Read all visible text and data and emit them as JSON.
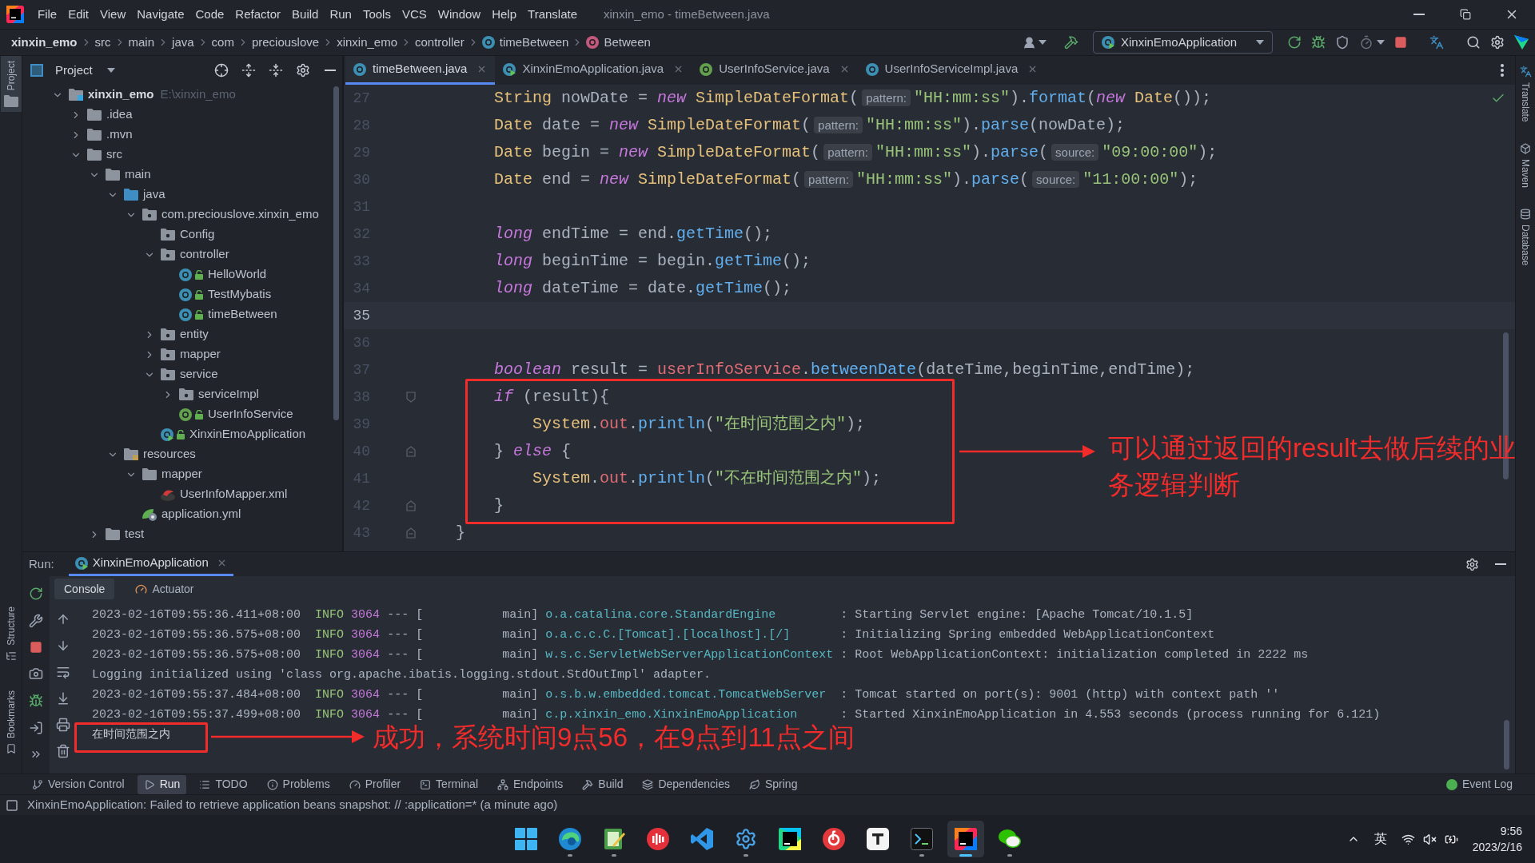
{
  "title_bar": {
    "menu": [
      "File",
      "Edit",
      "View",
      "Navigate",
      "Code",
      "Refactor",
      "Build",
      "Run",
      "Tools",
      "VCS",
      "Window",
      "Help",
      "Translate"
    ],
    "title": "xinxin_emo - timeBetween.java"
  },
  "navigation_bar": {
    "breadcrumbs": [
      {
        "label": "xinxin_emo",
        "kind": "project"
      },
      {
        "label": "src",
        "kind": "folder"
      },
      {
        "label": "main",
        "kind": "folder"
      },
      {
        "label": "java",
        "kind": "folder"
      },
      {
        "label": "com",
        "kind": "folder"
      },
      {
        "label": "preciouslove",
        "kind": "folder"
      },
      {
        "label": "xinxin_emo",
        "kind": "folder"
      },
      {
        "label": "controller",
        "kind": "folder"
      },
      {
        "label": "timeBetween",
        "kind": "class"
      },
      {
        "label": "Between",
        "kind": "method"
      }
    ],
    "run_configuration": "XinxinEmoApplication"
  },
  "left_stripe": {
    "top": [
      {
        "label": "Project",
        "kind": "project",
        "selected": true
      }
    ],
    "bottom": [
      {
        "label": "Structure",
        "kind": "structure",
        "selected": false
      },
      {
        "label": "Bookmarks",
        "kind": "bookmarks",
        "selected": false
      }
    ]
  },
  "project_panel": {
    "title": "Project",
    "tree": [
      {
        "label": "xinxin_emo",
        "path": "E:\\xinxin_emo",
        "kind": "module",
        "expanded": true,
        "children": [
          {
            "label": ".idea",
            "kind": "folder",
            "expanded": false
          },
          {
            "label": ".mvn",
            "kind": "folder",
            "expanded": false
          },
          {
            "label": "src",
            "kind": "folder",
            "expanded": true,
            "children": [
              {
                "label": "main",
                "kind": "folder",
                "expanded": true,
                "children": [
                  {
                    "label": "java",
                    "kind": "source",
                    "expanded": true,
                    "children": [
                      {
                        "label": "com.preciouslove.xinxin_emo",
                        "kind": "package",
                        "expanded": true,
                        "children": [
                          {
                            "label": "Config",
                            "kind": "package"
                          },
                          {
                            "label": "controller",
                            "kind": "package",
                            "expanded": true,
                            "children": [
                              {
                                "label": "HelloWorld",
                                "kind": "class"
                              },
                              {
                                "label": "TestMybatis",
                                "kind": "class"
                              },
                              {
                                "label": "timeBetween",
                                "kind": "class"
                              }
                            ]
                          },
                          {
                            "label": "entity",
                            "kind": "package",
                            "expanded": false
                          },
                          {
                            "label": "mapper",
                            "kind": "package",
                            "expanded": false
                          },
                          {
                            "label": "service",
                            "kind": "package",
                            "expanded": true,
                            "children": [
                              {
                                "label": "serviceImpl",
                                "kind": "package",
                                "expanded": false
                              },
                              {
                                "label": "UserInfoService",
                                "kind": "interface"
                              }
                            ]
                          },
                          {
                            "label": "XinxinEmoApplication",
                            "kind": "app"
                          }
                        ]
                      }
                    ]
                  },
                  {
                    "label": "resources",
                    "kind": "resources",
                    "expanded": true,
                    "children": [
                      {
                        "label": "mapper",
                        "kind": "folder",
                        "expanded": true,
                        "children": [
                          {
                            "label": "UserInfoMapper.xml",
                            "kind": "xml"
                          }
                        ]
                      },
                      {
                        "label": "application.yml",
                        "kind": "yml"
                      }
                    ]
                  }
                ]
              },
              {
                "label": "test",
                "kind": "folder",
                "expanded": false
              }
            ]
          }
        ]
      }
    ]
  },
  "editor": {
    "tabs": [
      {
        "label": "timeBetween.java",
        "kind": "class",
        "selected": true
      },
      {
        "label": "XinxinEmoApplication.java",
        "kind": "app",
        "selected": false
      },
      {
        "label": "UserInfoService.java",
        "kind": "interface",
        "selected": false
      },
      {
        "label": "UserInfoServiceImpl.java",
        "kind": "class",
        "selected": false
      }
    ],
    "lines": [
      {
        "number": "27",
        "kind": "plain",
        "current": false,
        "tokens": [
          {
            "text": "        String",
            "kind": "type"
          },
          {
            "text": " nowDate = ",
            "kind": "plain"
          },
          {
            "text": "new",
            "kind": "kw"
          },
          {
            "text": " SimpleDateFormat",
            "kind": "type"
          },
          {
            "text": "(",
            "kind": "plain"
          },
          {
            "text": "pattern:",
            "kind": "hint"
          },
          {
            "text": "\"HH:mm:ss\"",
            "kind": "str"
          },
          {
            "text": ").",
            "kind": "plain"
          },
          {
            "text": "format",
            "kind": "method"
          },
          {
            "text": "(",
            "kind": "plain"
          },
          {
            "text": "new",
            "kind": "kw"
          },
          {
            "text": " Date",
            "kind": "type"
          },
          {
            "text": "());",
            "kind": "plain"
          }
        ]
      },
      {
        "number": "28",
        "kind": "plain",
        "current": false,
        "tokens": [
          {
            "text": "        Date",
            "kind": "type"
          },
          {
            "text": " date = ",
            "kind": "plain"
          },
          {
            "text": "new",
            "kind": "kw"
          },
          {
            "text": " SimpleDateFormat",
            "kind": "type"
          },
          {
            "text": "(",
            "kind": "plain"
          },
          {
            "text": "pattern:",
            "kind": "hint"
          },
          {
            "text": "\"HH:mm:ss\"",
            "kind": "str"
          },
          {
            "text": ").",
            "kind": "plain"
          },
          {
            "text": "parse",
            "kind": "method"
          },
          {
            "text": "(nowDate);",
            "kind": "plain"
          }
        ]
      },
      {
        "number": "29",
        "kind": "plain",
        "current": false,
        "tokens": [
          {
            "text": "        Date",
            "kind": "type"
          },
          {
            "text": " begin = ",
            "kind": "plain"
          },
          {
            "text": "new",
            "kind": "kw"
          },
          {
            "text": " SimpleDateFormat",
            "kind": "type"
          },
          {
            "text": "(",
            "kind": "plain"
          },
          {
            "text": "pattern:",
            "kind": "hint"
          },
          {
            "text": "\"HH:mm:ss\"",
            "kind": "str"
          },
          {
            "text": ").",
            "kind": "plain"
          },
          {
            "text": "parse",
            "kind": "method"
          },
          {
            "text": "(",
            "kind": "plain"
          },
          {
            "text": "source:",
            "kind": "hint"
          },
          {
            "text": "\"09:00:00\"",
            "kind": "str"
          },
          {
            "text": ");",
            "kind": "plain"
          }
        ]
      },
      {
        "number": "30",
        "kind": "plain",
        "current": false,
        "tokens": [
          {
            "text": "        Date",
            "kind": "type"
          },
          {
            "text": " end = ",
            "kind": "plain"
          },
          {
            "text": "new",
            "kind": "kw"
          },
          {
            "text": " SimpleDateFormat",
            "kind": "type"
          },
          {
            "text": "(",
            "kind": "plain"
          },
          {
            "text": "pattern:",
            "kind": "hint"
          },
          {
            "text": "\"HH:mm:ss\"",
            "kind": "str"
          },
          {
            "text": ").",
            "kind": "plain"
          },
          {
            "text": "parse",
            "kind": "method"
          },
          {
            "text": "(",
            "kind": "plain"
          },
          {
            "text": "source:",
            "kind": "hint"
          },
          {
            "text": "\"11:00:00\"",
            "kind": "str"
          },
          {
            "text": ");",
            "kind": "plain"
          }
        ]
      },
      {
        "number": "31",
        "kind": "plain",
        "current": false
      },
      {
        "number": "32",
        "kind": "plain",
        "current": false,
        "tokens": [
          {
            "text": "        long",
            "kind": "kw"
          },
          {
            "text": " endTime = end.",
            "kind": "plain"
          },
          {
            "text": "getTime",
            "kind": "method"
          },
          {
            "text": "();",
            "kind": "plain"
          }
        ]
      },
      {
        "number": "33",
        "kind": "plain",
        "current": false,
        "tokens": [
          {
            "text": "        long",
            "kind": "kw"
          },
          {
            "text": " beginTime = begin.",
            "kind": "plain"
          },
          {
            "text": "getTime",
            "kind": "method"
          },
          {
            "text": "();",
            "kind": "plain"
          }
        ]
      },
      {
        "number": "34",
        "kind": "plain",
        "current": false,
        "tokens": [
          {
            "text": "        long",
            "kind": "kw"
          },
          {
            "text": " dateTime = date.",
            "kind": "plain"
          },
          {
            "text": "getTime",
            "kind": "method"
          },
          {
            "text": "();",
            "kind": "plain"
          }
        ]
      },
      {
        "number": "35",
        "kind": "plain",
        "current": true
      },
      {
        "number": "36",
        "kind": "plain",
        "current": false
      },
      {
        "number": "37",
        "kind": "plain",
        "current": false,
        "tokens": [
          {
            "text": "        boolean",
            "kind": "kw"
          },
          {
            "text": " result = ",
            "kind": "plain"
          },
          {
            "text": "userInfoService",
            "kind": "field"
          },
          {
            "text": ".",
            "kind": "plain"
          },
          {
            "text": "betweenDate",
            "kind": "method"
          },
          {
            "text": "(dateTime,beginTime,endTime);",
            "kind": "plain"
          }
        ]
      },
      {
        "number": "38",
        "kind": "fold-start",
        "current": false,
        "tokens": [
          {
            "text": "        if",
            "kind": "kw"
          },
          {
            "text": " (result){",
            "kind": "plain"
          }
        ]
      },
      {
        "number": "39",
        "kind": "plain",
        "current": false,
        "tokens": [
          {
            "text": "            System",
            "kind": "type"
          },
          {
            "text": ".",
            "kind": "plain"
          },
          {
            "text": "out",
            "kind": "field"
          },
          {
            "text": ".",
            "kind": "plain"
          },
          {
            "text": "println",
            "kind": "method"
          },
          {
            "text": "(",
            "kind": "plain"
          },
          {
            "text": "\"在时间范围之内\"",
            "kind": "str"
          },
          {
            "text": ");",
            "kind": "plain"
          }
        ]
      },
      {
        "number": "40",
        "kind": "fold-end",
        "current": false,
        "tokens": [
          {
            "text": "        } ",
            "kind": "plain"
          },
          {
            "text": "else",
            "kind": "kw"
          },
          {
            "text": " {",
            "kind": "plain"
          }
        ]
      },
      {
        "number": "41",
        "kind": "plain",
        "current": false,
        "tokens": [
          {
            "text": "            System",
            "kind": "type"
          },
          {
            "text": ".",
            "kind": "plain"
          },
          {
            "text": "out",
            "kind": "field"
          },
          {
            "text": ".",
            "kind": "plain"
          },
          {
            "text": "println",
            "kind": "method"
          },
          {
            "text": "(",
            "kind": "plain"
          },
          {
            "text": "\"不在时间范围之内\"",
            "kind": "str"
          },
          {
            "text": ");",
            "kind": "plain"
          }
        ]
      },
      {
        "number": "42",
        "kind": "fold-end",
        "current": false,
        "tokens": [
          {
            "text": "        }",
            "kind": "plain"
          }
        ]
      },
      {
        "number": "43",
        "kind": "fold-end",
        "current": false,
        "tokens": [
          {
            "text": "    }",
            "kind": "plain"
          }
        ]
      }
    ],
    "callout": "可以通过返回的result去做后续的业务逻辑判断"
  },
  "right_stripe": [
    {
      "label": "Translate",
      "kind": "translate"
    },
    {
      "label": "Maven",
      "kind": "maven"
    },
    {
      "label": "Database",
      "kind": "database"
    }
  ],
  "run_panel": {
    "label": "Run:",
    "tabs": [
      {
        "label": "XinxinEmoApplication",
        "selected": true
      }
    ],
    "views": [
      {
        "label": "Console",
        "kind": "console",
        "selected": true
      },
      {
        "label": "Actuator",
        "kind": "actuator",
        "selected": false
      }
    ],
    "lines": [
      {
        "kind": "log",
        "timestamp": "2023-02-16T09:55:36.411+08:00",
        "level": "INFO",
        "pid": "3064",
        "thread": "--- [           main]",
        "logger": "o.a.catalina.core.StandardEngine",
        "message": ": Starting Servlet engine: [Apache Tomcat/10.1.5]"
      },
      {
        "kind": "log",
        "timestamp": "2023-02-16T09:55:36.575+08:00",
        "level": "INFO",
        "pid": "3064",
        "thread": "--- [           main]",
        "logger": "o.a.c.c.C.[Tomcat].[localhost].[/]",
        "message": ": Initializing Spring embedded WebApplicationContext"
      },
      {
        "kind": "log",
        "timestamp": "2023-02-16T09:55:36.575+08:00",
        "level": "INFO",
        "pid": "3064",
        "thread": "--- [           main]",
        "logger": "w.s.c.ServletWebServerApplicationContext",
        "message": ": Root WebApplicationContext: initialization completed in 2222 ms"
      },
      {
        "kind": "plain",
        "text": "Logging initialized using 'class org.apache.ibatis.logging.stdout.StdOutImpl' adapter."
      },
      {
        "kind": "log",
        "timestamp": "2023-02-16T09:55:37.484+08:00",
        "level": "INFO",
        "pid": "3064",
        "thread": "--- [           main]",
        "logger": "o.s.b.w.embedded.tomcat.TomcatWebServer",
        "message": ": Tomcat started on port(s): 9001 (http) with context path ''"
      },
      {
        "kind": "log",
        "timestamp": "2023-02-16T09:55:37.499+08:00",
        "level": "INFO",
        "pid": "3064",
        "thread": "--- [           main]",
        "logger": "c.p.xinxin_emo.XinxinEmoApplication",
        "message": ": Started XinxinEmoApplication in 4.553 seconds (process running for 6.121)"
      },
      {
        "kind": "output",
        "text": "在时间范围之内"
      }
    ],
    "callout": "成功，系统时间9点56，在9点到11点之间"
  },
  "tool_window_bar": {
    "left": [
      {
        "label": "Version Control",
        "kind": "vcs",
        "selected": false
      },
      {
        "label": "Run",
        "kind": "run",
        "selected": true
      },
      {
        "label": "TODO",
        "kind": "todo",
        "selected": false
      },
      {
        "label": "Problems",
        "kind": "problems",
        "selected": false
      },
      {
        "label": "Profiler",
        "kind": "profiler",
        "selected": false
      },
      {
        "label": "Terminal",
        "kind": "terminal",
        "selected": false
      },
      {
        "label": "Endpoints",
        "kind": "endpoints",
        "selected": false
      },
      {
        "label": "Build",
        "kind": "build",
        "selected": false
      },
      {
        "label": "Dependencies",
        "kind": "dependencies",
        "selected": false
      },
      {
        "label": "Spring",
        "kind": "spring",
        "selected": false
      }
    ],
    "right": [
      {
        "label": "Event Log",
        "kind": "event-log",
        "selected": false
      }
    ]
  },
  "status_bar": {
    "message": "XinxinEmoApplication: Failed to retrieve application beans snapshot: // :application=* (a minute ago)"
  },
  "taskbar": {
    "apps": [
      {
        "kind": "start",
        "running": false,
        "selected": false
      },
      {
        "kind": "browser",
        "running": true,
        "selected": false
      },
      {
        "kind": "notebook",
        "running": true,
        "selected": false
      },
      {
        "kind": "bars",
        "running": false,
        "selected": false
      },
      {
        "kind": "ribbon",
        "running": false,
        "selected": false
      },
      {
        "kind": "gear",
        "running": true,
        "selected": false
      },
      {
        "kind": "tile",
        "running": false,
        "selected": false
      },
      {
        "kind": "disc",
        "running": false,
        "selected": false
      },
      {
        "kind": "paper",
        "running": false,
        "selected": false
      },
      {
        "kind": "console",
        "running": true,
        "selected": false
      },
      {
        "kind": "ide",
        "running": true,
        "selected": true
      },
      {
        "kind": "chat",
        "running": true,
        "selected": false
      }
    ],
    "tray": {
      "input_method": "英",
      "time": "9:56",
      "date": "2023/2/16"
    }
  }
}
